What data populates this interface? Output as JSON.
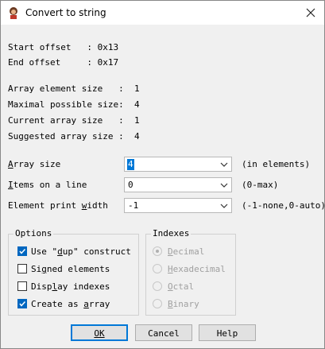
{
  "window": {
    "title": "Convert to string",
    "close_glyph": "✕"
  },
  "info": {
    "start_offset": "Start offset   : 0x13",
    "end_offset": "End offset     : 0x17",
    "array_element_size": "Array element size   :  1",
    "maximal_possible_size": "Maximal possible size:  4",
    "current_array_size": "Current array size   :  1",
    "suggested_array_size": "Suggested array size :  4"
  },
  "fields": {
    "array_size": {
      "label_pre": "",
      "label_ul": "A",
      "label_post": "rray size",
      "value": "4",
      "hint": "(in elements)"
    },
    "items_on_line": {
      "label_pre": "",
      "label_ul": "I",
      "label_post": "tems on a line",
      "value": "0",
      "hint": "(0-max)"
    },
    "print_width": {
      "label_pre": "Element print ",
      "label_ul": "w",
      "label_post": "idth",
      "value": "-1",
      "hint": "(-1-none,0-auto)"
    }
  },
  "options": {
    "title": "Options",
    "items": [
      {
        "pre": "Use \"",
        "ul": "d",
        "post": "up\" construct",
        "checked": true
      },
      {
        "pre": "Si",
        "ul": "g",
        "post": "ned elements",
        "checked": false
      },
      {
        "pre": "Disp",
        "ul": "l",
        "post": "ay indexes",
        "checked": false
      },
      {
        "pre": "Create as ",
        "ul": "a",
        "post": "rray",
        "checked": true
      }
    ]
  },
  "indexes": {
    "title": "Indexes",
    "items": [
      {
        "pre": "",
        "ul": "D",
        "post": "ecimal",
        "selected": true
      },
      {
        "pre": "",
        "ul": "H",
        "post": "exadecimal",
        "selected": false
      },
      {
        "pre": "",
        "ul": "O",
        "post": "ctal",
        "selected": false
      },
      {
        "pre": "",
        "ul": "B",
        "post": "inary",
        "selected": false
      }
    ]
  },
  "buttons": {
    "ok": "OK",
    "cancel": "Cancel",
    "help": "Help"
  },
  "colors": {
    "accent": "#0078d7",
    "checkbox_checked": "#0067c0"
  }
}
